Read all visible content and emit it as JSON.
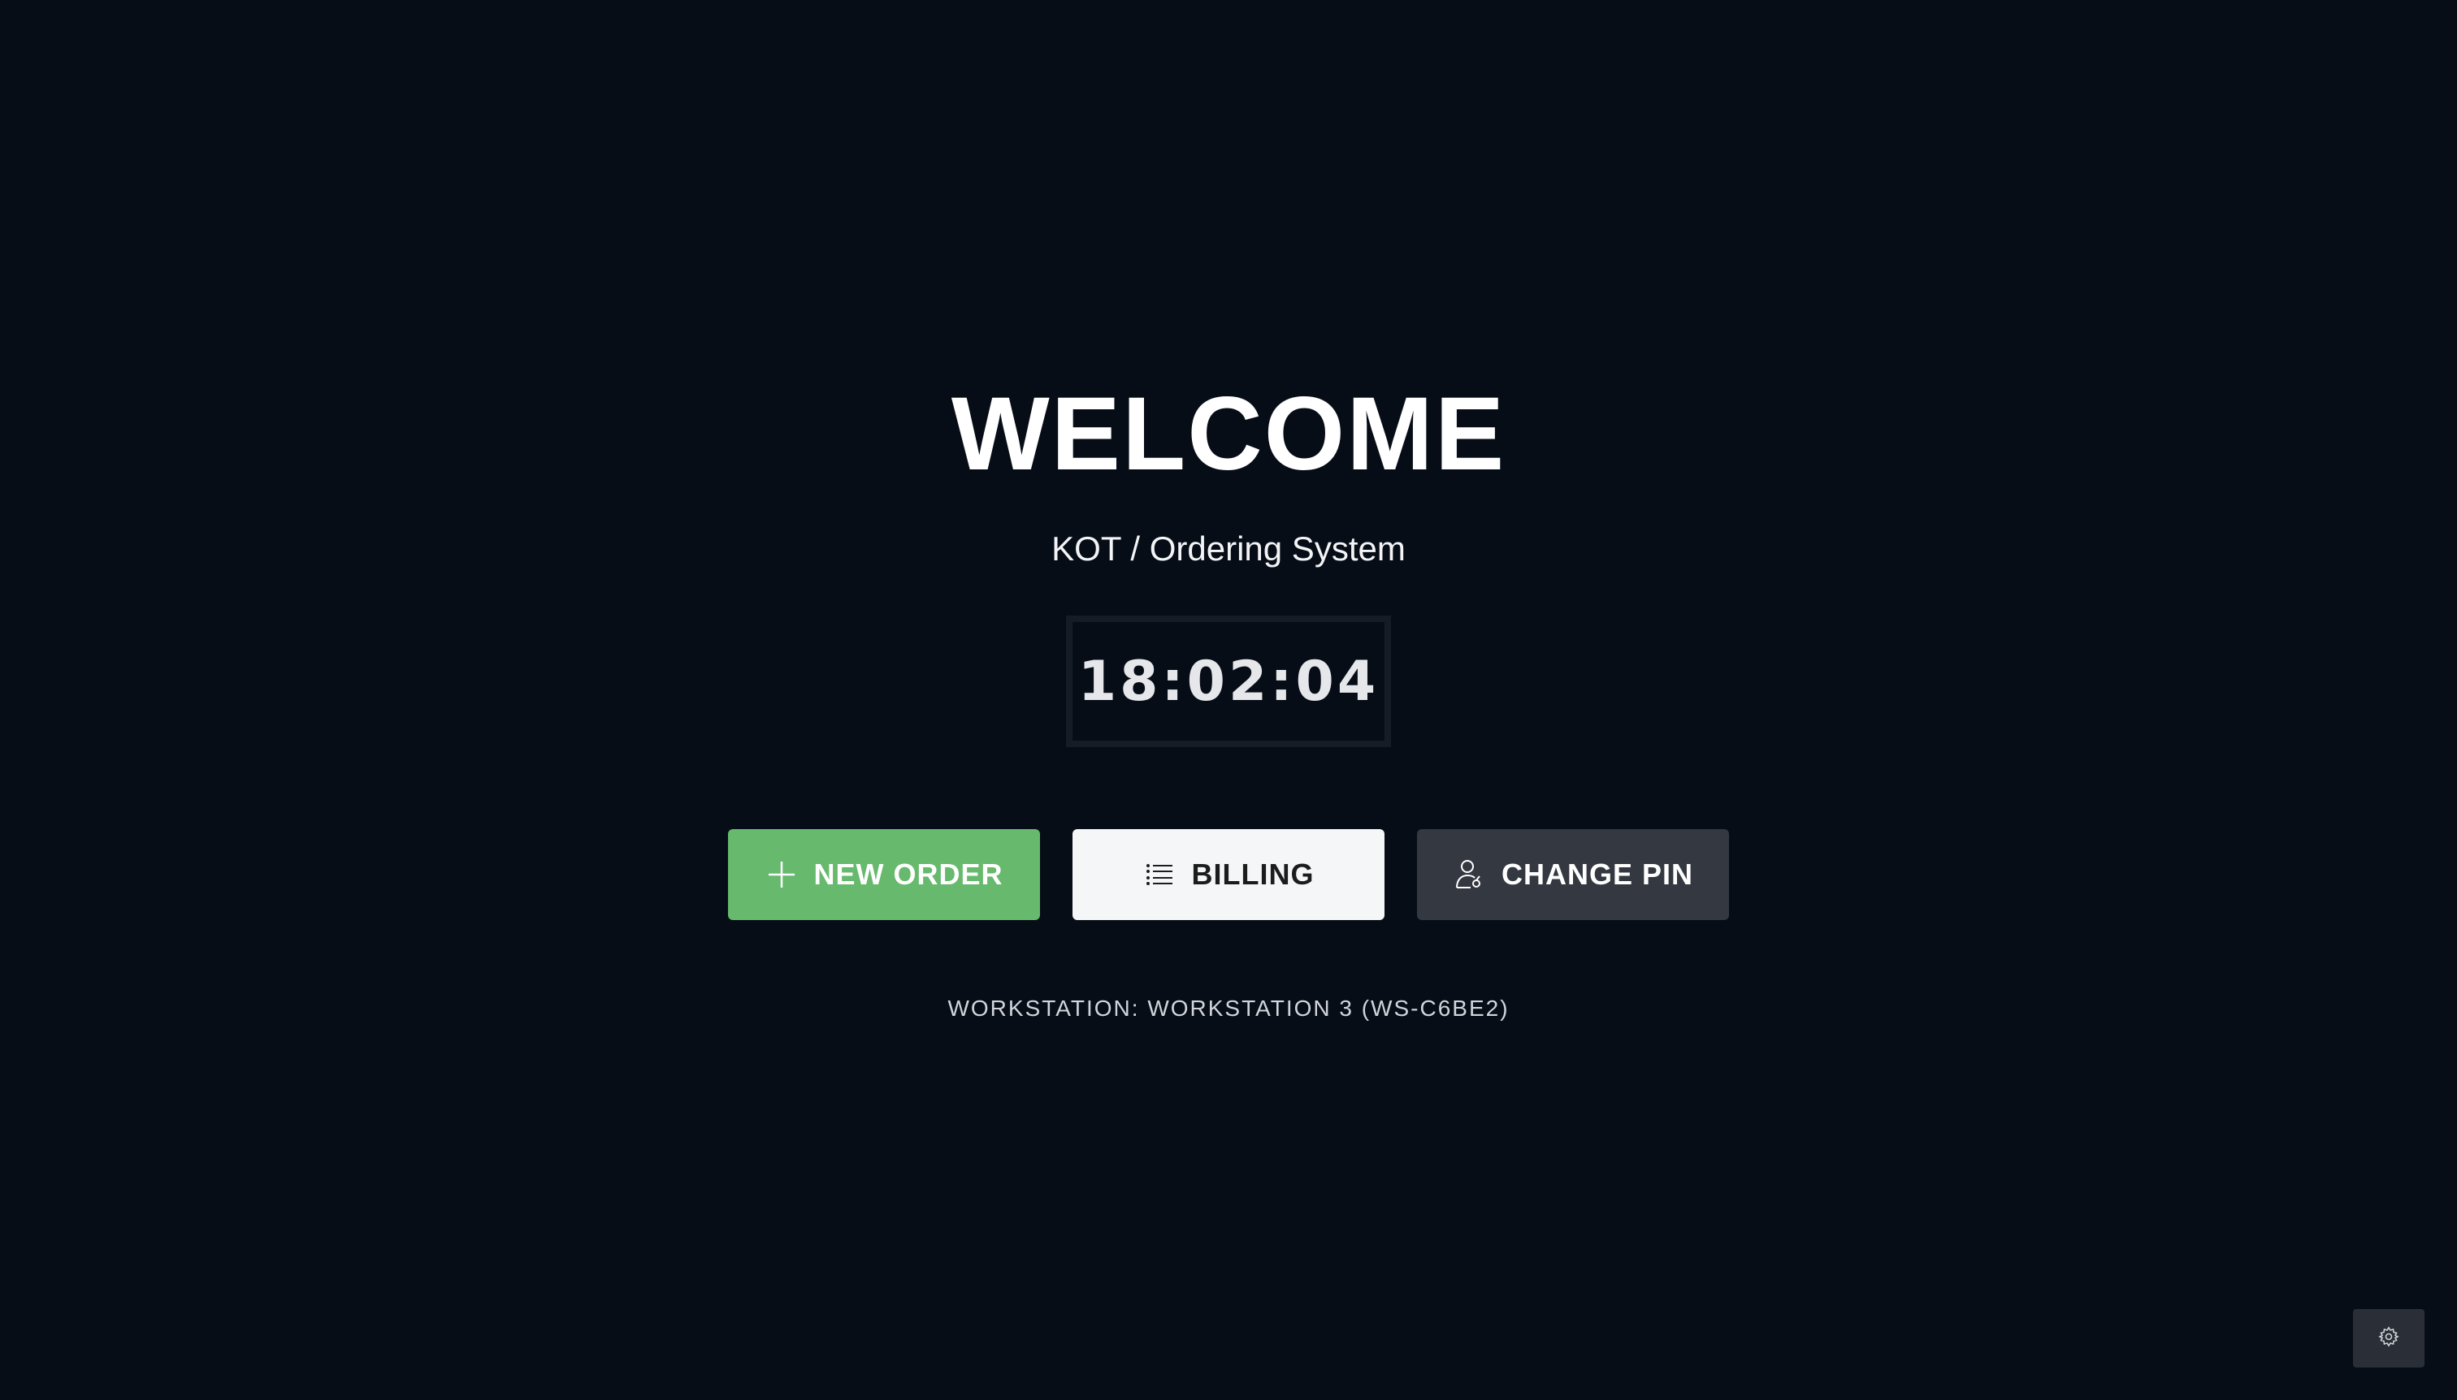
{
  "welcome": {
    "title": "WELCOME",
    "subtitle": "KOT / Ordering System"
  },
  "clock": {
    "time": "18:02:04"
  },
  "actions": {
    "new_order": {
      "label": "NEW ORDER",
      "icon": "plus-icon",
      "color": "#66b96d"
    },
    "billing": {
      "label": "BILLING",
      "icon": "list-icon",
      "color": "#f4f6f8"
    },
    "change_pin": {
      "label": "CHANGE PIN",
      "icon": "user-key-icon",
      "color": "#343840"
    }
  },
  "footer": {
    "workstation": "WORKSTATION: WORKSTATION 3 (WS-C6BE2)"
  },
  "settings": {
    "icon": "gear-icon"
  },
  "colors": {
    "background": "#070d17",
    "accent_green": "#66b96d"
  }
}
